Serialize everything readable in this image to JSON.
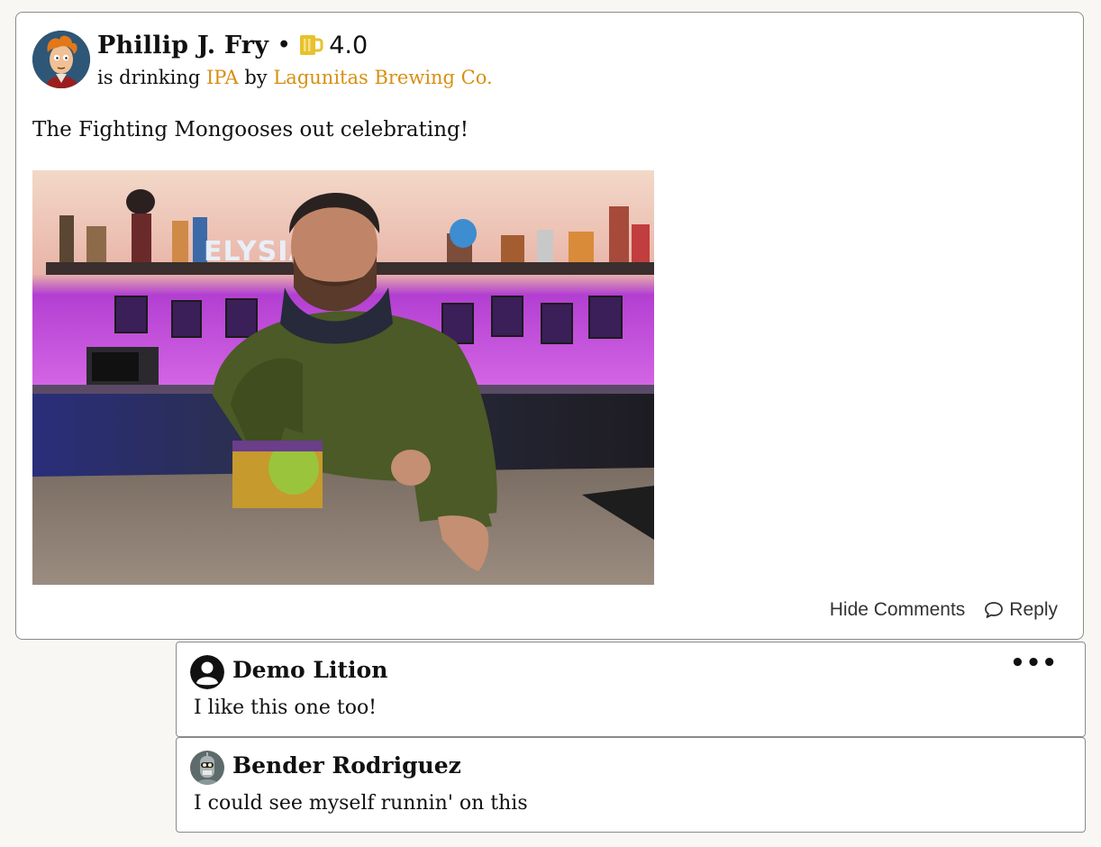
{
  "post": {
    "user_name": "Phillip J. Fry",
    "separator": "•",
    "rating": "4.0",
    "rating_icon": "beer-mug-icon",
    "drinking_prefix": "is drinking",
    "beer_name": "IPA",
    "by_word": "by",
    "brewery_name": "Lagunitas Brewing Co.",
    "caption": "The Fighting Mongooses out celebrating!",
    "photo_sign_text": "ELYSIAN",
    "actions": {
      "hide_comments": "Hide Comments",
      "reply": "Reply"
    },
    "colors": {
      "link": "#d88f12",
      "rating_icon": "#e8c12c"
    }
  },
  "comments": [
    {
      "user_name": "Demo Lition",
      "text": "I like this one too!",
      "avatar": "default-user-icon",
      "more_menu": "•••"
    },
    {
      "user_name": "Bender Rodriguez",
      "text": "I could see myself runnin' on this",
      "avatar": "bender-avatar"
    }
  ]
}
